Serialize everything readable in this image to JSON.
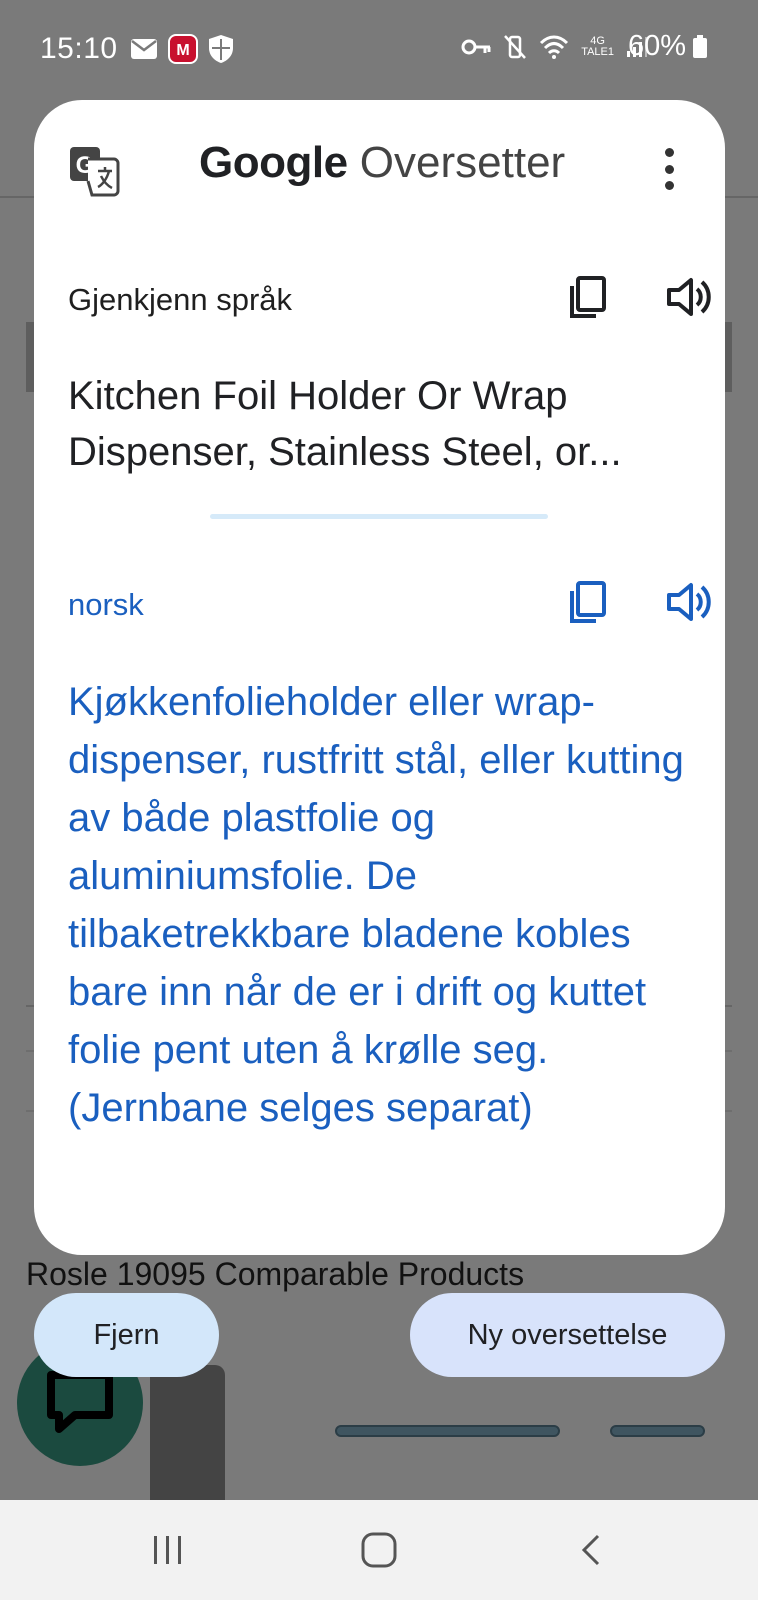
{
  "status_bar": {
    "time": "15:10",
    "network_top": "4G",
    "network_bottom": "TALE1",
    "battery": "60%"
  },
  "background": {
    "comparable_products": "Rosle 19095 Comparable Products"
  },
  "translate_popup": {
    "app_brand_google": "Google",
    "app_brand_rest": "Oversetter",
    "source": {
      "language": "Gjenkjenn språk",
      "text": "Kitchen Foil Holder Or Wrap Dispenser, Stainless Steel, or..."
    },
    "target": {
      "language": "norsk",
      "text": "Kjøkkenfolieholder eller wrap-dispenser, rustfritt stål, eller kutting av både plastfolie og aluminiumsfolie. De tilbaketrekkbare bladene kobles bare inn når de er i drift og kuttet folie pent uten å krølle seg.  (Jernbane selges separat)"
    }
  },
  "actions": {
    "remove_label": "Fjern",
    "new_translation_label": "Ny oversettelse"
  },
  "colors": {
    "accent": "#1a5fbf",
    "card_bg": "#ffffff",
    "overlay": "#7a7a7a",
    "remove_btn": "#d3e7fa",
    "new_btn": "#d8e3fb"
  },
  "icons": {
    "translate_logo": "google-translate-icon",
    "copy": "copy-icon",
    "speaker": "speaker-icon",
    "more": "more-vert-icon",
    "chat": "chat-icon"
  }
}
